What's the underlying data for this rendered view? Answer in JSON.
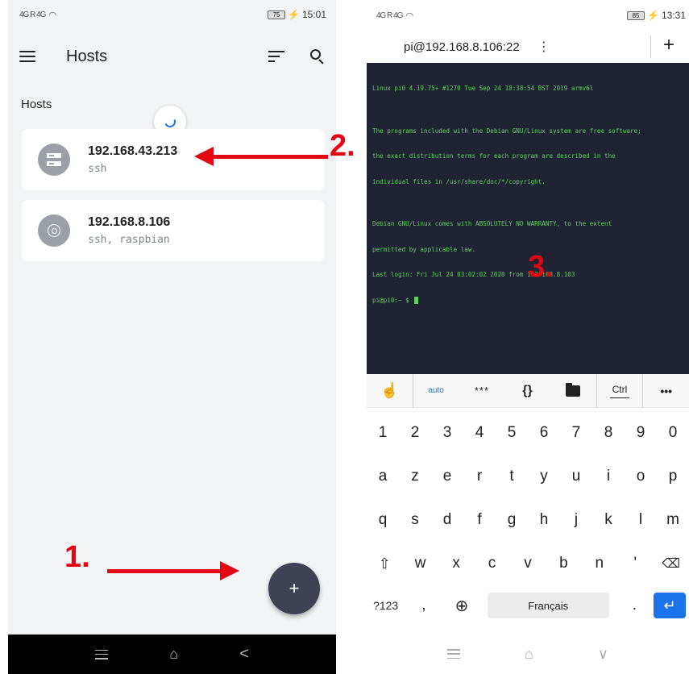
{
  "left": {
    "status": {
      "network": "4G R 4G",
      "battery": "75",
      "time": "15:01"
    },
    "appbar": {
      "title": "Hosts",
      "menu_icon": "hamburger-icon",
      "sort_icon": "sort-icon",
      "search_icon": "search-icon"
    },
    "section_label": "Hosts",
    "hosts": [
      {
        "name": "192.168.43.213",
        "tags": "ssh",
        "icon": "server-icon"
      },
      {
        "name": "192.168.8.106",
        "tags": "ssh, raspbian",
        "icon": "raspberry-pi-icon"
      }
    ],
    "fab_label": "+",
    "nav": {
      "menu": "menu-icon",
      "home": "⌂",
      "back": "<"
    }
  },
  "right": {
    "status": {
      "network": "4G R 4G",
      "battery": "85",
      "time": "13:31"
    },
    "appbar": {
      "title": "pi@192.168.8.106:22",
      "more": "⋮",
      "add": "+"
    },
    "terminal_lines": [
      "Linux pi0 4.19.75+ #1270 Tue Sep 24 18:38:54 BST 2019 armv6l",
      "",
      "The programs included with the Debian GNU/Linux system are free software;",
      "the exact distribution terms for each program are described in the",
      "individual files in /usr/share/doc/*/copyright.",
      "",
      "Debian GNU/Linux comes with ABSOLUTELY NO WARRANTY, to the extent",
      "permitted by applicable law.",
      "Last login: Fri Jul 24 03:02:02 2020 from 192.168.8.103"
    ],
    "prompt": "pi@pi0:~ $ ",
    "extra_keys": {
      "auto": "auto",
      "password": "***",
      "braces": "{}",
      "ctrl": "Ctrl",
      "more": "•••"
    },
    "keyboard": {
      "row1": [
        "1",
        "2",
        "3",
        "4",
        "5",
        "6",
        "7",
        "8",
        "9",
        "0"
      ],
      "row2": [
        "a",
        "z",
        "e",
        "r",
        "t",
        "y",
        "u",
        "i",
        "o",
        "p"
      ],
      "row3": [
        "q",
        "s",
        "d",
        "f",
        "g",
        "h",
        "j",
        "k",
        "l",
        "m"
      ],
      "row4": [
        "w",
        "x",
        "c",
        "v",
        "b",
        "n",
        "'"
      ],
      "sym": "?123",
      "comma": ",",
      "space": "Français",
      "period": "."
    },
    "nav": {
      "menu": "menu-icon",
      "home": "⌂",
      "down": "∨"
    }
  },
  "annotations": {
    "one": "1.",
    "two": "2.",
    "three": "3."
  },
  "colors": {
    "annotation_red": "#e30613",
    "fab": "#3f4255",
    "terminal_bg": "#1f2333",
    "terminal_text": "#5bd35b",
    "accent": "#1a73e8"
  }
}
